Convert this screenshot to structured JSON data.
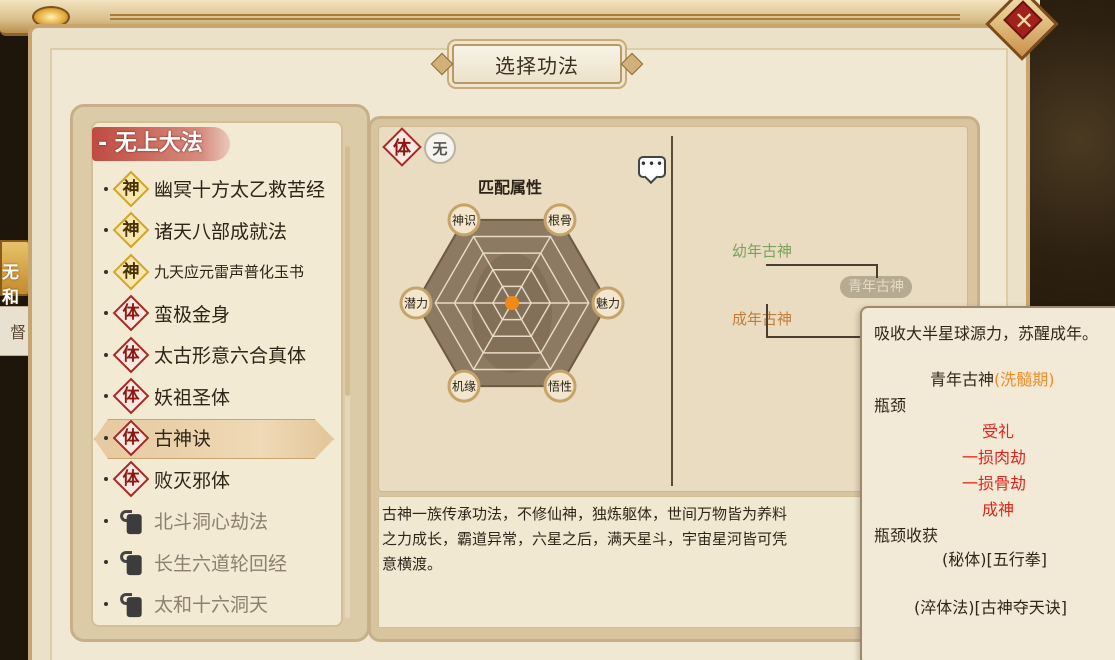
{
  "window": {
    "title": "选择功法",
    "left_stub_text": "无和",
    "left_stub2_text": "督"
  },
  "category": {
    "label": "- 无上大法"
  },
  "techniques": [
    {
      "name": "幽冥十方太乙救苦经",
      "type": "神",
      "kind": "shen",
      "size": "normal",
      "locked": false,
      "selected": false
    },
    {
      "name": "诸天八部成就法",
      "type": "神",
      "kind": "shen",
      "size": "normal",
      "locked": false,
      "selected": false
    },
    {
      "name": "九天应元雷声普化玉书",
      "type": "神",
      "kind": "shen",
      "size": "small",
      "locked": false,
      "selected": false
    },
    {
      "name": "蛮极金身",
      "type": "体",
      "kind": "ti",
      "size": "normal",
      "locked": false,
      "selected": false
    },
    {
      "name": "太古形意六合真体",
      "type": "体",
      "kind": "ti",
      "size": "normal",
      "locked": false,
      "selected": false
    },
    {
      "name": "妖祖圣体",
      "type": "体",
      "kind": "ti",
      "size": "normal",
      "locked": false,
      "selected": false
    },
    {
      "name": "古神诀",
      "type": "体",
      "kind": "ti",
      "size": "normal",
      "locked": false,
      "selected": true
    },
    {
      "name": "败灭邪体",
      "type": "体",
      "kind": "ti",
      "size": "normal",
      "locked": false,
      "selected": false
    },
    {
      "name": "北斗洞心劫法",
      "type": "",
      "kind": "lock",
      "size": "normal",
      "locked": true,
      "selected": false
    },
    {
      "name": "长生六道轮回经",
      "type": "",
      "kind": "lock",
      "size": "normal",
      "locked": true,
      "selected": false
    },
    {
      "name": "太和十六洞天",
      "type": "",
      "kind": "lock",
      "size": "normal",
      "locked": true,
      "selected": false
    }
  ],
  "detail": {
    "type_badge": "体",
    "element_badge": "无",
    "chat_icon": "speech-bubble-icon",
    "match_title": "匹配属性",
    "attributes": [
      "神识",
      "根骨",
      "魅力",
      "悟性",
      "机缘",
      "潜力"
    ],
    "stages": {
      "young": "幼年古神",
      "middle": "青年古神",
      "adult": "成年古神"
    },
    "description": "古神一族传承功法，不修仙神，独炼躯体，世间万物皆为养料，之力成长，霸道异常，六星之后，满天星斗，宇宙星河皆可凭意横渡。",
    "description_lines": [
      "古神一族传承功法，不修仙神，独炼躯体，世间万物皆为养料",
      "之力成长，霸道异常，六星之后，满天星斗，宇宙星河皆可凭",
      "意横渡。"
    ]
  },
  "tooltip": {
    "intro": "吸收大半星球源力，苏醒成年。",
    "stage_name": "青年古神",
    "stage_period": "(洗髓期)",
    "bottleneck_label": "瓶颈",
    "trials": [
      "受礼",
      "一损肉劫",
      "一损骨劫",
      "成神"
    ],
    "reward_label": "瓶颈收获",
    "rewards": [
      "(秘体)[五行拳]",
      "(淬体法)[古神夺天诀]"
    ]
  },
  "colors": {
    "accent_red": "#a72a22",
    "tooltip_red": "#e0251b",
    "period_orange": "#ef8e2a",
    "young_green": "#7aa25a",
    "adult_orange": "#c27d3a",
    "radar_center": "#f08a17"
  }
}
